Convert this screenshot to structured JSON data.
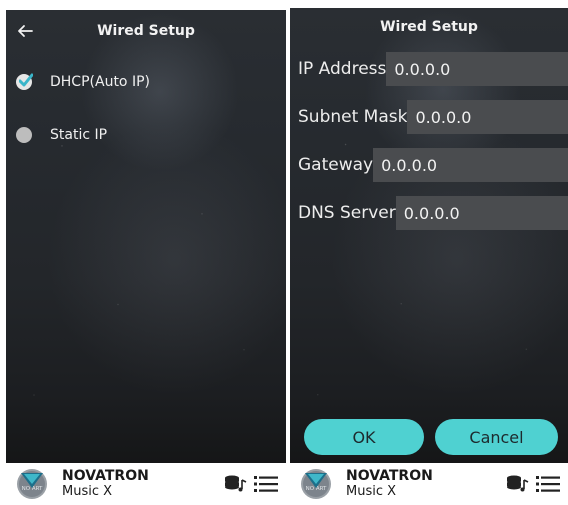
{
  "left_screen": {
    "title": "Wired Setup",
    "options": [
      {
        "label": "DHCP(Auto IP)",
        "selected": true
      },
      {
        "label": "Static IP",
        "selected": false
      }
    ]
  },
  "right_screen": {
    "title": "Wired Setup",
    "fields": [
      {
        "label": "IP Address",
        "value": "0.0.0.0"
      },
      {
        "label": "Subnet Mask",
        "value": "0.0.0.0"
      },
      {
        "label": "Gateway",
        "value": "0.0.0.0"
      },
      {
        "label": "DNS Server",
        "value": "0.0.0.0"
      }
    ],
    "ok_label": "OK",
    "cancel_label": "Cancel"
  },
  "footer": {
    "brand_name": "NOVATRON",
    "brand_sub": "Music X",
    "logo_text": "NO ART",
    "icons": [
      "music-library-icon",
      "menu-list-icon"
    ]
  },
  "colors": {
    "accent": "#4fd1d1",
    "check": "#3ab5c9",
    "field_bg": "#4a4c4f"
  }
}
